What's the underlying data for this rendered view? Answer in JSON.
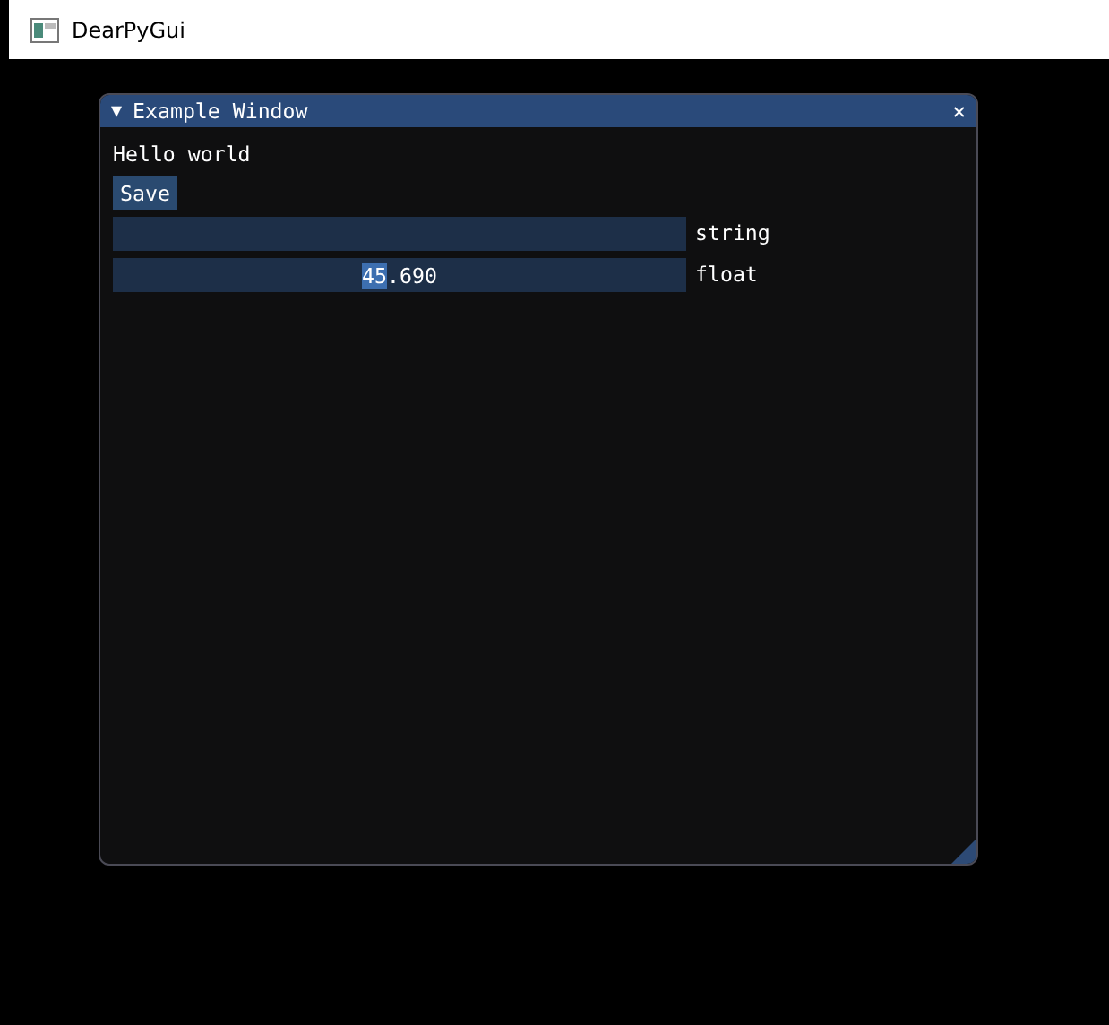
{
  "app_window": {
    "title": "DearPyGui"
  },
  "panel": {
    "title": "Example Window",
    "collapse_glyph": "▼",
    "close_glyph": "✕",
    "expanded": true,
    "items": [
      {
        "kind": "text",
        "text": "Hello world"
      },
      {
        "kind": "button",
        "label": "Save"
      },
      {
        "kind": "input",
        "label": "string"
      },
      {
        "kind": "input",
        "label": "float",
        "parts": [
          {
            "text": "45",
            "selected": true
          },
          {
            "text": ".690",
            "selected": false
          }
        ]
      }
    ]
  }
}
